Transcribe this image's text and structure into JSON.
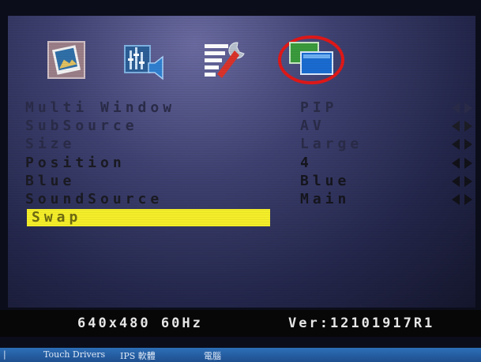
{
  "osd": {
    "tabs": [
      {
        "name": "picture-tab",
        "icon": "picture-icon",
        "selected": false
      },
      {
        "name": "audio-tab",
        "icon": "speaker-equalizer-icon",
        "selected": false
      },
      {
        "name": "setup-tab",
        "icon": "wrench-settings-icon",
        "selected": false
      },
      {
        "name": "multi-window-tab",
        "icon": "multi-window-icon",
        "selected": true
      }
    ],
    "menu": [
      {
        "label": "Multi Window",
        "value": "PIP"
      },
      {
        "label": "SubSource",
        "value": "AV"
      },
      {
        "label": "Size",
        "value": "Large"
      },
      {
        "label": "Position",
        "value": "4"
      },
      {
        "label": "Blue",
        "value": "Blue"
      },
      {
        "label": "SoundSource",
        "value": "Main"
      },
      {
        "label": "Swap",
        "value": "",
        "highlighted": true
      }
    ],
    "highlight_color": "#f4ee2a",
    "selection_ring_color": "#e01818"
  },
  "status": {
    "resolution": "640x480 60Hz",
    "version": "Ver:12101917R1"
  },
  "taskbar": {
    "items": [
      "Touch Drivers",
      "IPS 軟體",
      "電腦"
    ]
  }
}
